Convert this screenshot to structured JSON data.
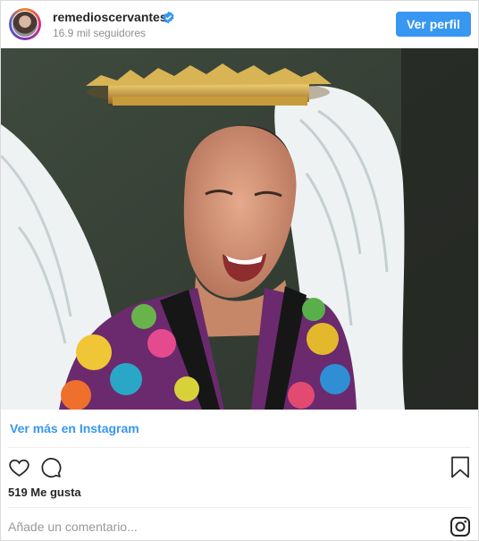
{
  "header": {
    "username": "remedioscervantes",
    "followers": "16.9 mil seguidores",
    "profile_button": "Ver perfil"
  },
  "post": {
    "more_link": "Ver más en Instagram",
    "likes": "519 Me gusta",
    "comment_placeholder": "Añade un comentario..."
  },
  "icons": {
    "like": "heart-icon",
    "comment": "comment-icon",
    "save": "bookmark-icon",
    "brand": "instagram-icon",
    "verified": "verified-badge-icon"
  },
  "colors": {
    "accent": "#3897f0",
    "text": "#262626",
    "muted": "#8e8e8e"
  }
}
